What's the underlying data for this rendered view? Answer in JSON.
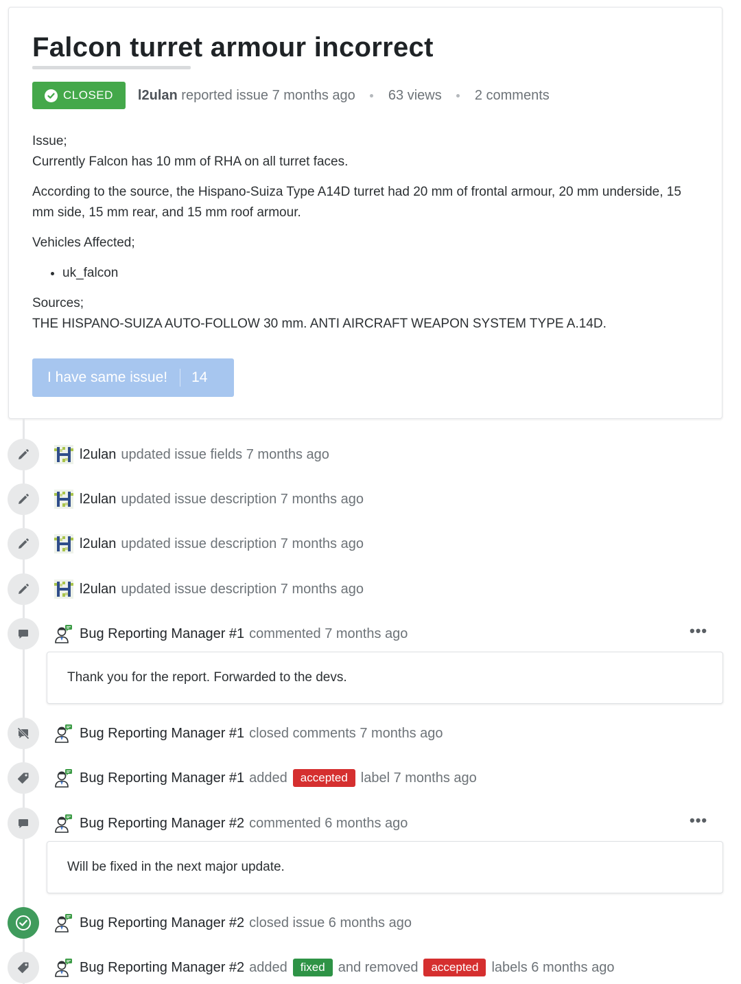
{
  "issue": {
    "title": "Falcon turret armour incorrect",
    "status": "CLOSED",
    "reporter": "l2ulan",
    "reported_text": "reported issue 7 months ago",
    "views": "63 views",
    "comments": "2 comments",
    "body": {
      "p1_line1": "Issue;",
      "p1_line2": "Currently Falcon has 10 mm of RHA on all turret faces.",
      "p2": "According to the source, the Hispano-Suiza Type A14D turret had 20 mm of frontal armour, 20 mm underside, 15 mm side, 15 mm rear, and 15 mm roof armour.",
      "p3": "Vehicles Affected;",
      "list": [
        "uk_falcon"
      ],
      "p4_line1": "Sources;",
      "p4_line2": "THE HISPANO-SUIZA AUTO-FOLLOW 30 mm. ANTI AIRCRAFT WEAPON SYSTEM TYPE A.14D."
    },
    "same_issue_button": {
      "label": "I have same issue!",
      "count": "14"
    }
  },
  "timeline": [
    {
      "icon": "pencil-icon",
      "user": "l2ulan",
      "action": "updated issue fields 7 months ago"
    },
    {
      "icon": "pencil-icon",
      "user": "l2ulan",
      "action": "updated issue description 7 months ago"
    },
    {
      "icon": "pencil-icon",
      "user": "l2ulan",
      "action": "updated issue description 7 months ago"
    },
    {
      "icon": "pencil-icon",
      "user": "l2ulan",
      "action": "updated issue description 7 months ago"
    },
    {
      "icon": "comment-icon",
      "user": "Bug Reporting Manager #1",
      "action": "commented 7 months ago",
      "comment": "Thank you for the report. Forwarded to the devs."
    },
    {
      "icon": "comment-closed-icon",
      "user": "Bug Reporting Manager #1",
      "action": "closed comments 7 months ago"
    },
    {
      "icon": "tag-icon",
      "user": "Bug Reporting Manager #1",
      "pre": "added",
      "label": "accepted",
      "post": "label 7 months ago"
    },
    {
      "icon": "comment-icon",
      "user": "Bug Reporting Manager #2",
      "action": "commented 6 months ago",
      "comment": "Will be fixed in the next major update."
    },
    {
      "icon": "check-circle-icon",
      "user": "Bug Reporting Manager #2",
      "action": "closed issue 6 months ago"
    },
    {
      "icon": "tag-icon",
      "user": "Bug Reporting Manager #2",
      "pre": "added",
      "label1": "fixed",
      "mid": "and removed",
      "label2": "accepted",
      "post": "labels 6 months ago"
    }
  ],
  "more_menu_glyph": "•••",
  "colors": {
    "closed_badge": "#44a84a",
    "label_accepted": "#d52f2f",
    "label_fixed": "#2e9346",
    "button": "#a7c6ef"
  }
}
